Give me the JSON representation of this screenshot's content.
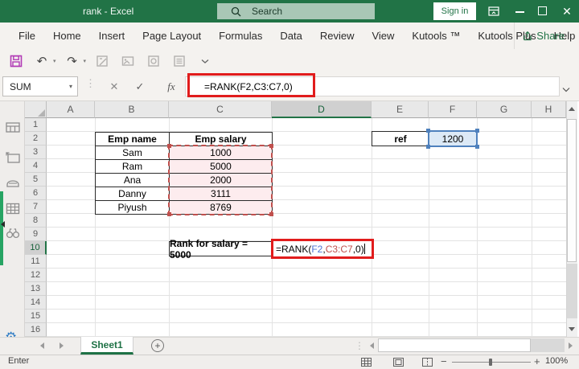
{
  "titlebar": {
    "title": "rank - Excel",
    "search_placeholder": "Search",
    "sign_in": "Sign in"
  },
  "ribbon": {
    "tabs": [
      "File",
      "Home",
      "Insert",
      "Page Layout",
      "Formulas",
      "Data",
      "Review",
      "View",
      "Kutools ™",
      "Kutools Plus",
      "Help"
    ],
    "share_label": "Share"
  },
  "formula_bar": {
    "name_box": "SUM",
    "fx_label": "fx",
    "formula": "=RANK(F2,C3:C7,0)"
  },
  "grid": {
    "col_headers": [
      "A",
      "B",
      "C",
      "D",
      "E",
      "F",
      "G",
      "H"
    ],
    "row_numbers": [
      "1",
      "2",
      "3",
      "4",
      "5",
      "6",
      "7",
      "8",
      "9",
      "10",
      "11",
      "12",
      "13",
      "14",
      "15",
      "16"
    ],
    "active_column": "D",
    "active_row": "10"
  },
  "cells": {
    "emp_table": {
      "headers": [
        "Emp name",
        "Emp salary"
      ],
      "rows": [
        {
          "name": "Sam",
          "salary": "1000"
        },
        {
          "name": "Ram",
          "salary": "5000"
        },
        {
          "name": "Ana",
          "salary": "2000"
        },
        {
          "name": "Danny",
          "salary": "3111"
        },
        {
          "name": "Piyush",
          "salary": "8769"
        }
      ]
    },
    "ref": {
      "label": "ref",
      "value": "1200"
    },
    "rank_label": "Rank for salary = 5000",
    "rank_formula": {
      "part1": "=RANK(",
      "ref1": "F2",
      "comma1": ",",
      "ref2": "C3:C7",
      "part2": ",0)"
    }
  },
  "sheet_tabs": {
    "active": "Sheet1",
    "add_label": "+"
  },
  "status_bar": {
    "mode": "Enter",
    "zoom_level": "100%"
  },
  "colors": {
    "excel_green": "#217346",
    "annotation_red": "#e11c1c",
    "selection_blue": "#4f81bd",
    "range_fill_pink": "#fdecee",
    "range_border_red": "#c0504d",
    "formula_ref1_blue": "#4f74d2",
    "formula_ref2_red": "#c0504d"
  }
}
